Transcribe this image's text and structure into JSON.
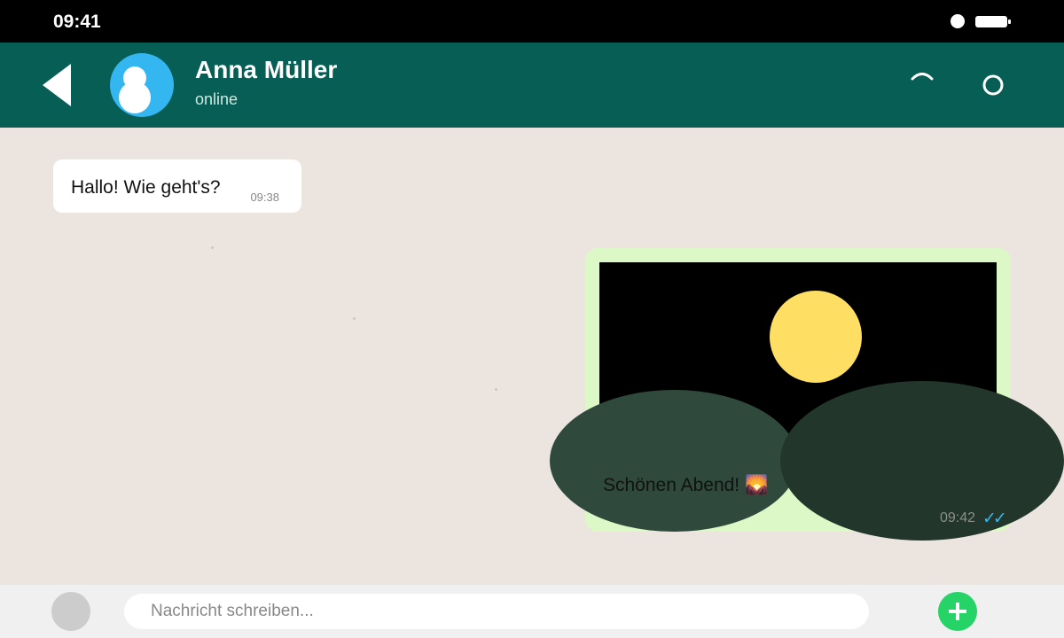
{
  "status_bar": {
    "time": "09:41"
  },
  "header": {
    "contact_name": "Anna Müller",
    "contact_status": "online",
    "icons": [
      "back-arrow-icon",
      "avatar",
      "call-icon",
      "menu-circle-icon"
    ]
  },
  "messages": [
    {
      "direction": "incoming",
      "text": "Hallo! Wie geht's?",
      "time": "09:38"
    },
    {
      "direction": "outgoing",
      "caption": "Schönen Abend! 🌄",
      "time": "09:42",
      "status_ticks": "✓✓",
      "has_image": true
    }
  ],
  "input_bar": {
    "placeholder": "Nachricht schreiben...",
    "value": ""
  },
  "colors": {
    "header": "#075e54",
    "chat_background": "#ece5df",
    "incoming_bubble": "#ffffff",
    "outgoing_bubble": "#dcf8c6",
    "avatar": "#34b7f1",
    "send_button": "#25d366",
    "read_ticks": "#34b7f1",
    "moon": "#ffdf63",
    "hill_dark": "#22362b",
    "hill_mid": "#2f4a3c"
  }
}
